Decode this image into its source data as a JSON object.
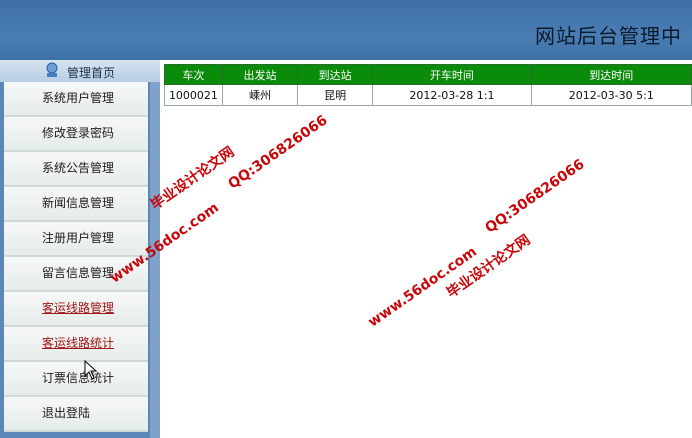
{
  "header": {
    "title": "网站后台管理中"
  },
  "sidebar": {
    "home_label": "管理首页",
    "items": [
      {
        "label": "系统用户管理"
      },
      {
        "label": "修改登录密码"
      },
      {
        "label": "系统公告管理"
      },
      {
        "label": "新闻信息管理"
      },
      {
        "label": "注册用户管理"
      },
      {
        "label": "留言信息管理"
      },
      {
        "label": "客运线路管理"
      },
      {
        "label": "客运线路统计"
      },
      {
        "label": "订票信息统计"
      },
      {
        "label": "退出登陆"
      }
    ]
  },
  "table": {
    "headers": [
      "车次",
      "出发站",
      "到达站",
      "开车时间",
      "到达时间"
    ],
    "rows": [
      [
        "1000021",
        "嵊州",
        "昆明",
        "2012-03-28 1:1",
        "2012-03-30 5:1"
      ]
    ]
  },
  "watermarks": {
    "site": "www.56doc.com",
    "qq": "QQ:306826066",
    "brand": "毕业设计论文网"
  },
  "colors": {
    "header": "#4a7db3",
    "table_header": "#0a8b0a",
    "watermark": "#c8070b",
    "active_link": "#a31616"
  }
}
